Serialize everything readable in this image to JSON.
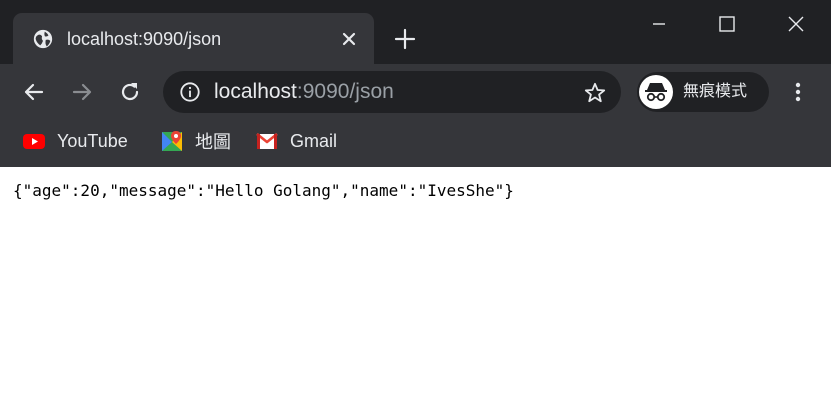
{
  "tab": {
    "title": "localhost:9090/json",
    "icon": "globe-icon"
  },
  "address_bar": {
    "host": "localhost",
    "path": ":9090/json"
  },
  "profile": {
    "label": "無痕模式",
    "icon": "incognito-icon"
  },
  "bookmarks": [
    {
      "label": "YouTube",
      "icon": "youtube-icon"
    },
    {
      "label": "地圖",
      "icon": "maps-icon"
    },
    {
      "label": "Gmail",
      "icon": "gmail-icon"
    }
  ],
  "page": {
    "body_text": "{\"age\":20,\"message\":\"Hello Golang\",\"name\":\"IvesShe\"}"
  },
  "colors": {
    "titlebar_bg": "#202124",
    "toolbar_bg": "#35363a",
    "text_light": "#e8eaed",
    "text_dim": "#9aa0a6"
  }
}
